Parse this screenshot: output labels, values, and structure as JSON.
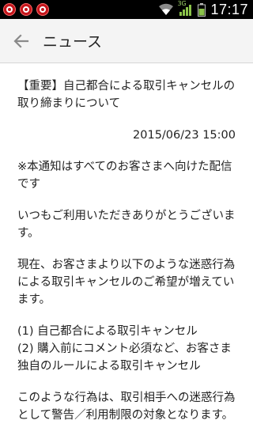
{
  "status_bar": {
    "time": "17:17",
    "network": "3G",
    "icons": [
      "notification-icon",
      "notification-icon",
      "notification-icon",
      "wifi-icon",
      "signal-icon",
      "battery-icon"
    ]
  },
  "app_bar": {
    "back_icon": "arrow-left-icon",
    "title": "ニュース"
  },
  "news": {
    "headline": "【重要】自己都合による取引キャンセルの取り締まりについて",
    "date": "2015/06/23 15:00",
    "paragraphs": [
      "※本通知はすべてのお客さまへ向けた配信です",
      "いつもご利用いただきありがとうございます。",
      "現在、お客さまより以下のような迷惑行為による取引キャンセルのご希望が増えています。",
      "(1) 自己都合による取引キャンセル\n(2) 購入前にコメント必須など、お客さま独自のルールによる取引キャンセル",
      "このような行為は、取引相手への迷惑行為として警告／利用制限の対象となります。"
    ]
  },
  "colors": {
    "status_bar": "#000000",
    "app_bar": "#f4f4f4",
    "notification_red": "#c4161c",
    "battery_green": "#8bc34a"
  }
}
